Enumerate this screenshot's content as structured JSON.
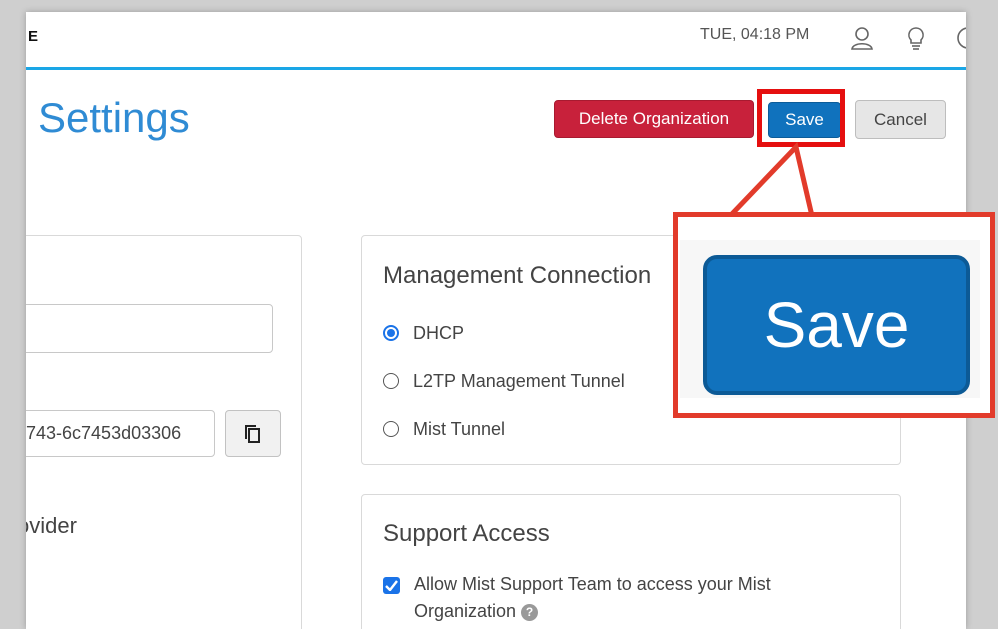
{
  "topbar": {
    "brand": "E",
    "clock": "TUE, 04:18 PM",
    "icons": [
      "user-icon",
      "lightbulb-icon",
      "help-circle-icon"
    ]
  },
  "page": {
    "title": "Settings",
    "buttons": {
      "delete": "Delete Organization",
      "save": "Save",
      "cancel": "Cancel"
    }
  },
  "left_card": {
    "name_value": "",
    "org_id_value": "743-6c7453d03306",
    "provider_label": "ovider"
  },
  "management": {
    "title": "Management Connection",
    "options": [
      {
        "label": "DHCP",
        "selected": true
      },
      {
        "label": "L2TP Management Tunnel",
        "selected": false
      },
      {
        "label": "Mist Tunnel",
        "selected": false
      }
    ]
  },
  "support": {
    "title": "Support Access",
    "checkbox_label_line1": "Allow Mist Support Team to access your Mist",
    "checkbox_label_line2": "Organization",
    "checked": true
  },
  "callout": {
    "zoom_label": "Save"
  },
  "colors": {
    "accent": "#1aa6e6",
    "save": "#1072bd",
    "delete": "#c8213b",
    "highlight": "#e50f0f"
  }
}
